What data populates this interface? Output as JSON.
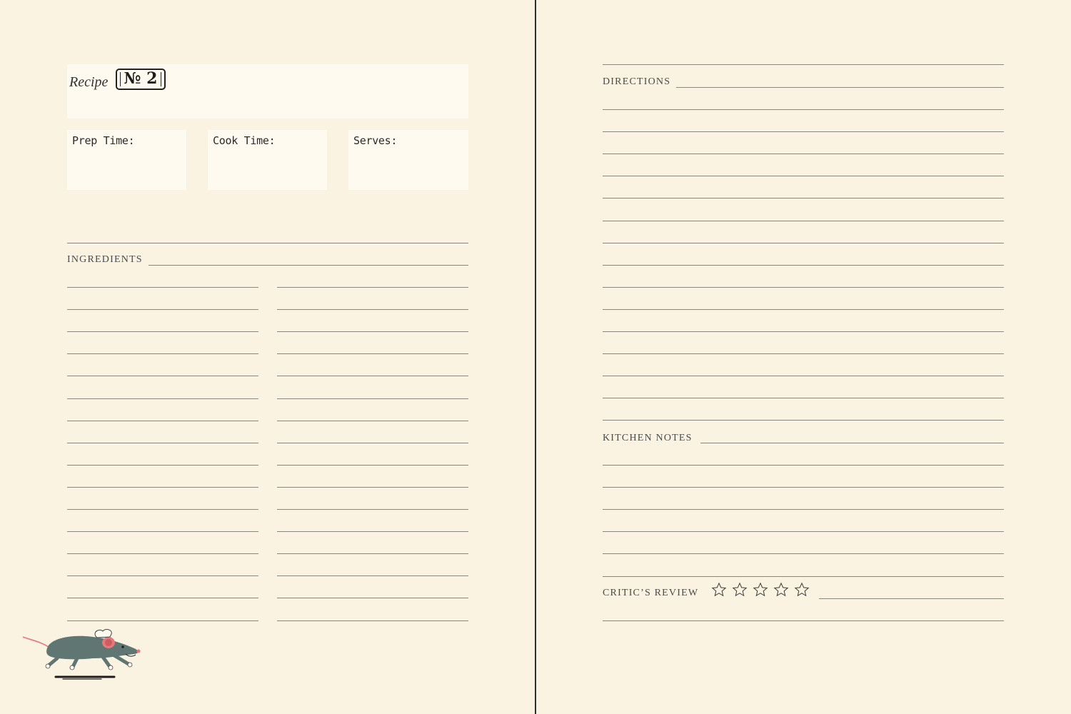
{
  "header": {
    "recipe_word": "Recipe",
    "recipe_number": "№ 2"
  },
  "meta": {
    "prep_label": "Prep Time:",
    "cook_label": "Cook Time:",
    "serves_label": "Serves:"
  },
  "sections": {
    "ingredients": "INGREDIENTS",
    "directions": "DIRECTIONS",
    "kitchen_notes": "KITCHEN NOTES",
    "critics_review": "CRITIC’S REVIEW"
  },
  "rating": {
    "stars_total": 5,
    "stars_filled": 0
  },
  "illustration": {
    "icon": "chef-rat-icon"
  },
  "colors": {
    "paper": "#faf3e2",
    "box": "#fffaf0",
    "rule": "#8a8780",
    "rat_body": "#5f7673",
    "rat_ear": "#e8777a"
  }
}
